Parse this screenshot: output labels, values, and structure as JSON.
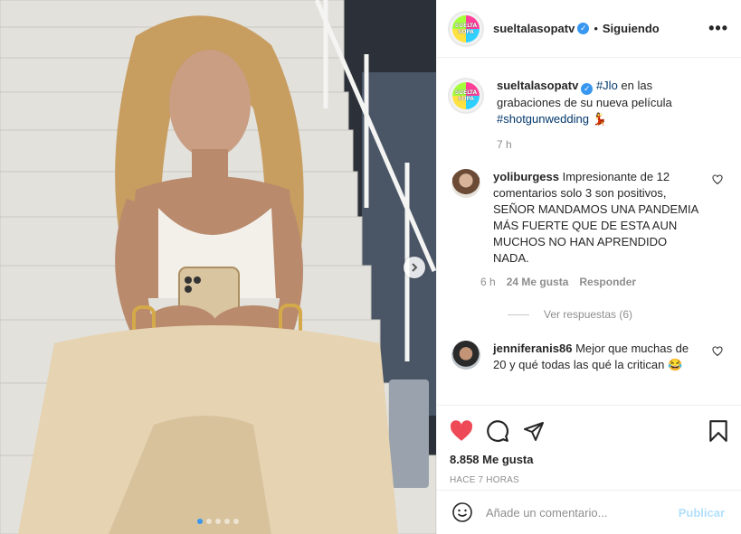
{
  "post": {
    "next_icon": "chevron-right-icon",
    "carousel_count": 5,
    "carousel_active": 1
  },
  "header": {
    "username": "sueltalasopatv",
    "logo_line1": "SUELTA",
    "logo_line2": "SOPA",
    "follow_status": "Siguiendo",
    "more_icon": "more-options-icon",
    "more_label": "•••"
  },
  "caption": {
    "username": "sueltalasopatv",
    "hashtag1": "#Jlo",
    "text": " en las grabaciones de su nueva película ",
    "hashtag2": "#shotgunwedding",
    "emoji": "💃",
    "time": "7 h"
  },
  "comments": [
    {
      "username": "yoliburgess",
      "text": "Impresionante de 12 comentarios solo 3 son positivos, SEÑOR MANDAMOS UNA PANDEMIA MÁS FUERTE QUE DE ESTA AUN MUCHOS NO HAN APRENDIDO NADA.",
      "time": "6 h",
      "likes": "24 Me gusta",
      "reply": "Responder",
      "view_replies": "Ver respuestas (6)"
    },
    {
      "username": "jenniferanis86",
      "text": "Mejor que muchas de 20 y qué todas las qué la critican 😂"
    }
  ],
  "actions": {
    "likes_total": "8.858 Me gusta",
    "post_time": "HACE 7 HORAS"
  },
  "add_comment": {
    "placeholder": "Añade un comentario...",
    "post_label": "Publicar"
  },
  "colors": {
    "like_red": "#ed4956",
    "verified_blue": "#3897f0",
    "link_blue": "#00376b",
    "post_disabled": "#b2dffc"
  }
}
